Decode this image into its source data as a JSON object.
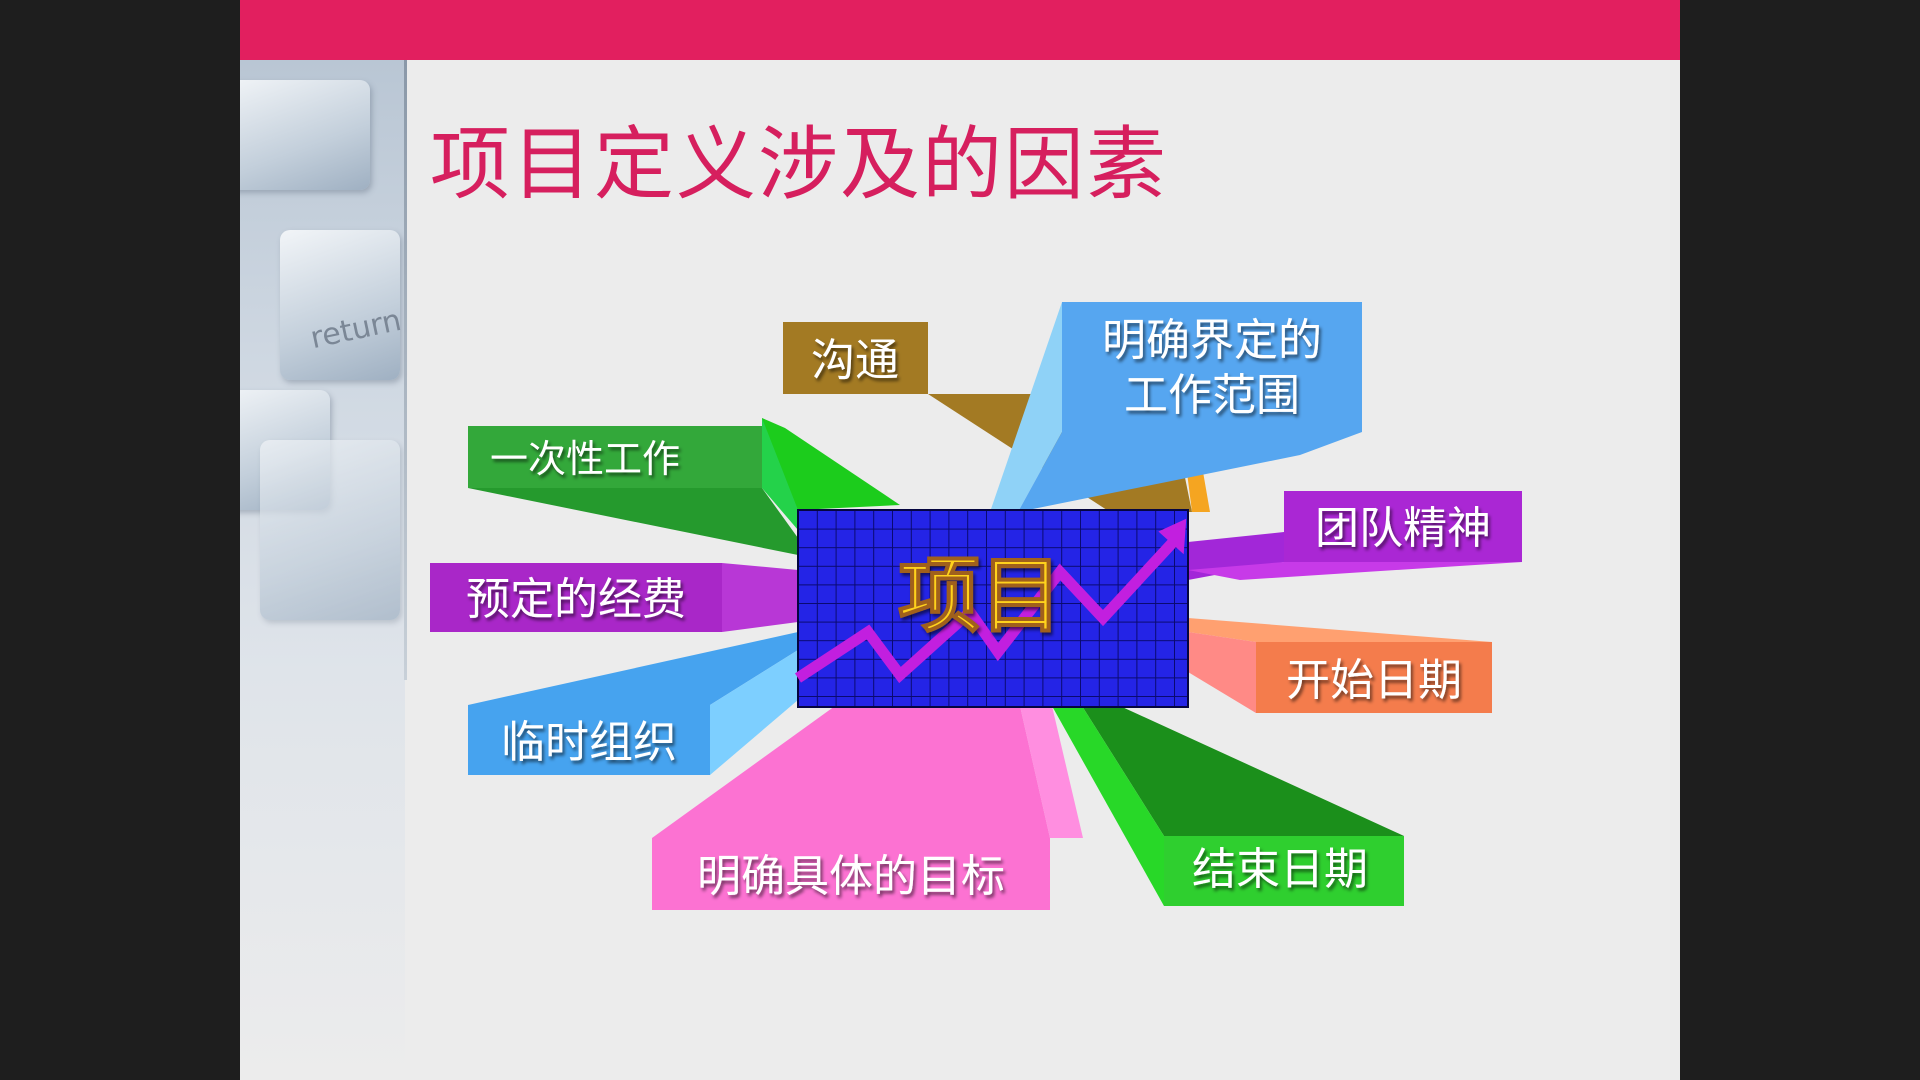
{
  "slide": {
    "title": "项目定义涉及的因素",
    "decoration_key_text": "return"
  },
  "colors": {
    "top_bar": "#e21f5f",
    "title": "#d61f5e",
    "center_fill": "#2424e6",
    "center_grid": "#0a0a70",
    "center_label": "#ffd21f",
    "trend_arrow": "#c21fdf"
  },
  "diagram": {
    "center": {
      "label": "项目"
    },
    "factors": [
      {
        "id": "communication",
        "label": "沟通",
        "color": "#a37a23"
      },
      {
        "id": "scope",
        "label_lines": [
          "明确界定的",
          "工作范围"
        ],
        "color": "#56a6f0"
      },
      {
        "id": "one-time-work",
        "label": "一次性工作",
        "color": "#33a83a"
      },
      {
        "id": "team-spirit",
        "label": "团队精神",
        "color": "#aa27d4"
      },
      {
        "id": "budget",
        "label": "预定的经费",
        "color": "#a927c8"
      },
      {
        "id": "start-date",
        "label": "开始日期",
        "color": "#f47c4c"
      },
      {
        "id": "temp-org",
        "label": "临时组织",
        "color": "#46a3ef"
      },
      {
        "id": "goal",
        "label": "明确具体的目标",
        "color": "#fc72d2"
      },
      {
        "id": "end-date",
        "label": "结束日期",
        "color": "#2fcf2f"
      }
    ]
  }
}
